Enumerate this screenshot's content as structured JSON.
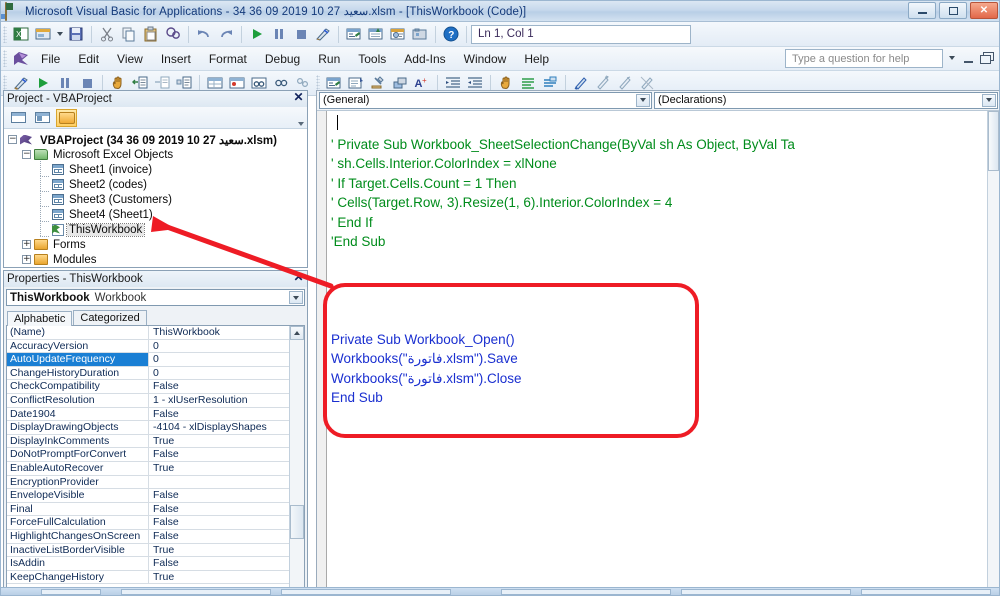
{
  "window": {
    "title": "Microsoft Visual Basic for Applications - 34 36 09  2019 10 27 سعيد.xlsm - [ThisWorkbook (Code)]",
    "app_icon": "vba-excel-icon",
    "minimize_label": "",
    "restore_label": "",
    "close_label": "✕"
  },
  "menu": {
    "items": [
      {
        "label": "File"
      },
      {
        "label": "Edit"
      },
      {
        "label": "View"
      },
      {
        "label": "Insert"
      },
      {
        "label": "Format"
      },
      {
        "label": "Debug"
      },
      {
        "label": "Run"
      },
      {
        "label": "Tools"
      },
      {
        "label": "Add-Ins"
      },
      {
        "label": "Window"
      },
      {
        "label": "Help"
      }
    ],
    "help_search_placeholder": "Type a question for help"
  },
  "toolbar_standard": {
    "position_indicator": "Ln 1, Col 1",
    "buttons": [
      {
        "name": "view-excel-icon"
      },
      {
        "name": "insert-userform-icon"
      },
      {
        "name": "insert-dropdown-icon"
      },
      {
        "name": "save-icon"
      },
      {
        "name": "cut-icon"
      },
      {
        "name": "copy-icon"
      },
      {
        "name": "paste-icon"
      },
      {
        "name": "find-icon"
      },
      {
        "name": "undo-icon"
      },
      {
        "name": "redo-icon"
      },
      {
        "name": "run-icon"
      },
      {
        "name": "break-icon"
      },
      {
        "name": "reset-icon"
      },
      {
        "name": "design-mode-icon"
      },
      {
        "name": "project-explorer-icon"
      },
      {
        "name": "properties-window-icon"
      },
      {
        "name": "object-browser-icon"
      },
      {
        "name": "toolbox-icon"
      },
      {
        "name": "help-icon"
      }
    ]
  },
  "toolbar_edit": {
    "buttons": [
      {
        "name": "design-mode-icon"
      },
      {
        "name": "run-icon"
      },
      {
        "name": "break-icon"
      },
      {
        "name": "reset-icon"
      },
      {
        "name": "drag-hand-icon"
      },
      {
        "name": "list-properties-methods-icon"
      },
      {
        "name": "list-constants-icon"
      },
      {
        "name": "quick-info-icon"
      },
      {
        "name": "parameter-info-icon"
      },
      {
        "name": "complete-word-icon"
      },
      {
        "name": "locals-window-icon"
      },
      {
        "name": "immediate-window-icon"
      },
      {
        "name": "watch-window-icon"
      },
      {
        "name": "quick-watch-icon"
      },
      {
        "name": "call-stack-icon"
      },
      {
        "name": "indent-icon"
      },
      {
        "name": "outdent-icon"
      },
      {
        "name": "toggle-breakpoint-icon"
      },
      {
        "name": "comment-block-icon"
      },
      {
        "name": "uncomment-block-icon"
      },
      {
        "name": "toggle-bookmark-icon"
      },
      {
        "name": "next-bookmark-icon"
      },
      {
        "name": "previous-bookmark-icon"
      },
      {
        "name": "clear-bookmarks-icon"
      }
    ]
  },
  "project_explorer": {
    "title": "Project - VBAProject",
    "close_label": "✕",
    "toolbar": [
      {
        "name": "view-code-icon"
      },
      {
        "name": "view-object-icon"
      },
      {
        "name": "toggle-folders-icon"
      }
    ],
    "tree": {
      "root": {
        "label": "VBAProject (34 36 09  2019 10 27 سعيد.xlsm)",
        "expander": "−"
      },
      "groups": [
        {
          "label": "Microsoft Excel Objects",
          "expander": "−",
          "children": [
            {
              "label": "Sheet1 (invoice)"
            },
            {
              "label": "Sheet2 (codes)"
            },
            {
              "label": "Sheet3 (Customers)"
            },
            {
              "label": "Sheet4 (Sheet1)"
            },
            {
              "label": "ThisWorkbook",
              "selected": true
            }
          ]
        },
        {
          "label": "Forms",
          "expander": "+",
          "children": []
        },
        {
          "label": "Modules",
          "expander": "+",
          "children": []
        }
      ]
    }
  },
  "properties_window": {
    "title": "Properties - ThisWorkbook",
    "close_label": "✕",
    "object_name": "ThisWorkbook",
    "object_type": "Workbook",
    "tabs": [
      {
        "label": "Alphabetic",
        "active": true
      },
      {
        "label": "Categorized",
        "active": false
      }
    ],
    "selected_property": "AutoUpdateFrequency",
    "rows": [
      {
        "name": "(Name)",
        "value": "ThisWorkbook"
      },
      {
        "name": "AccuracyVersion",
        "value": "0"
      },
      {
        "name": "AutoUpdateFrequency",
        "value": "0"
      },
      {
        "name": "ChangeHistoryDuration",
        "value": "0"
      },
      {
        "name": "CheckCompatibility",
        "value": "False"
      },
      {
        "name": "ConflictResolution",
        "value": "1 - xlUserResolution"
      },
      {
        "name": "Date1904",
        "value": "False"
      },
      {
        "name": "DisplayDrawingObjects",
        "value": "-4104 - xlDisplayShapes"
      },
      {
        "name": "DisplayInkComments",
        "value": "True"
      },
      {
        "name": "DoNotPromptForConvert",
        "value": "False"
      },
      {
        "name": "EnableAutoRecover",
        "value": "True"
      },
      {
        "name": "EncryptionProvider",
        "value": ""
      },
      {
        "name": "EnvelopeVisible",
        "value": "False"
      },
      {
        "name": "Final",
        "value": "False"
      },
      {
        "name": "ForceFullCalculation",
        "value": "False"
      },
      {
        "name": "HighlightChangesOnScreen",
        "value": "False"
      },
      {
        "name": "InactiveListBorderVisible",
        "value": "True"
      },
      {
        "name": "IsAddin",
        "value": "False"
      },
      {
        "name": "KeepChangeHistory",
        "value": "True"
      }
    ]
  },
  "code_window": {
    "object_dropdown": "(General)",
    "procedure_dropdown": "(Declarations)",
    "lines": [
      {
        "text": "",
        "style": "plain"
      },
      {
        "text": "'  Private Sub Workbook_SheetSelectionChange(ByVal sh As Object, ByVal Ta",
        "style": "comment"
      },
      {
        "text": "'    sh.Cells.Interior.ColorIndex = xlNone",
        "style": "comment"
      },
      {
        "text": "'    If Target.Cells.Count = 1 Then",
        "style": "comment"
      },
      {
        "text": "'      Cells(Target.Row, 3).Resize(1, 6).Interior.ColorIndex = 4",
        "style": "comment"
      },
      {
        "text": "'    End If",
        "style": "comment"
      },
      {
        "text": "'End Sub",
        "style": "comment"
      },
      {
        "text": "",
        "style": "plain"
      },
      {
        "text": "",
        "style": "plain"
      },
      {
        "text": "",
        "style": "plain"
      },
      {
        "text": "",
        "style": "plain"
      },
      {
        "text": "Private Sub Workbook_Open()",
        "style": "code"
      },
      {
        "text": "Workbooks(\"فاتورة.xlsm\").Save",
        "style": "code"
      },
      {
        "text": "Workbooks(\"فاتورة.xlsm\").Close",
        "style": "code"
      },
      {
        "text": "End Sub",
        "style": "code"
      }
    ]
  },
  "annotations": {
    "highlight_color": "#ee1c25",
    "rect_target": "workbook-open-procedure",
    "arrow_from": "thisworkbook-tree-node",
    "arrow_to": "workbook-open-procedure"
  },
  "colors": {
    "comment_green": "#008c1b",
    "keyword_blue": "#1a2fd0",
    "selection_blue": "#1a7fd4",
    "annotation_red": "#ee1c25",
    "title_text": "#13397a"
  }
}
